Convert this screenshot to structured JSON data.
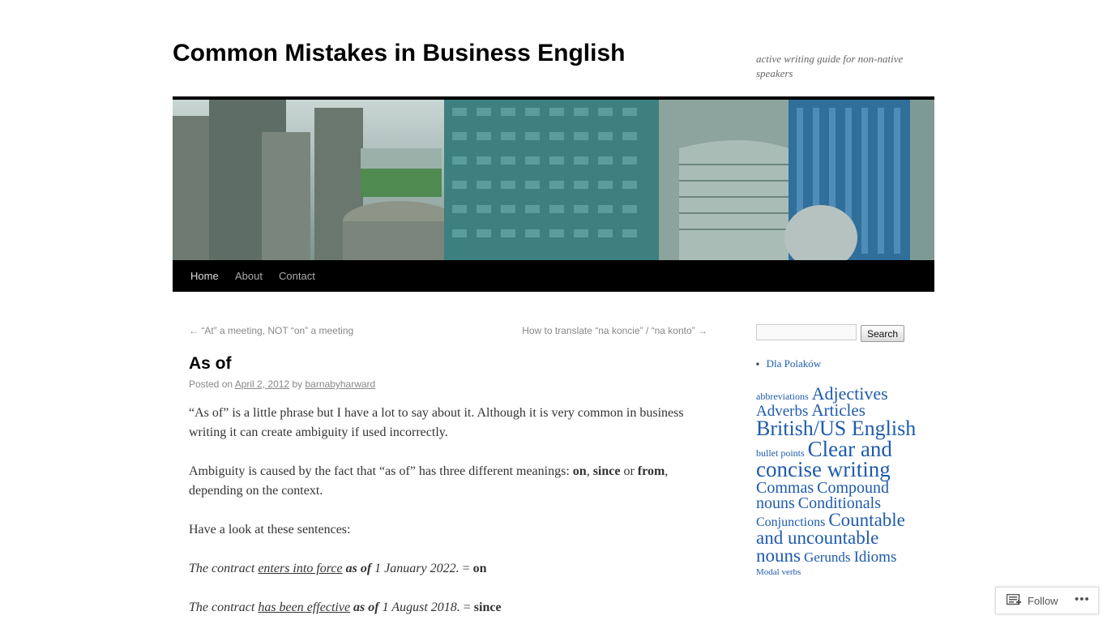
{
  "site": {
    "title": "Common Mistakes in Business English",
    "tagline": "active writing guide for non-native speakers"
  },
  "nav": {
    "items": [
      "Home",
      "About",
      "Contact"
    ]
  },
  "post_nav": {
    "prev_arrow": "←",
    "prev": "“At” a meeting, NOT “on” a meeting",
    "next": "How to translate “na koncie” / “na konto”",
    "next_arrow": "→"
  },
  "post": {
    "title": "As of",
    "posted_on": "Posted on",
    "date": "April 2, 2012",
    "by": "by",
    "author": "barnabyharward",
    "p1": "“As of” is a little phrase but I have a lot to say about it. Although it is very common in business writing it can create ambiguity if used incorrectly.",
    "p2_a": "Ambiguity is caused by the fact that “as of” has three different meanings: ",
    "p2_on": "on",
    "p2_comma": ", ",
    "p2_since": "since",
    "p2_or": " or ",
    "p2_from": "from",
    "p2_b": ", depending on the context.",
    "p3": "Have a look at these sentences:",
    "ex1_a": "The contract ",
    "ex1_u": "enters into force",
    "ex1_sp": " ",
    "ex1_asof": "as of",
    "ex1_date": " 1 January 2022.",
    "ex1_eq": " = ",
    "ex1_mean": "on",
    "ex2_a": "The contract ",
    "ex2_u": "has been effective",
    "ex2_sp": " ",
    "ex2_asof": "as of",
    "ex2_date": " 1 August 2018.",
    "ex2_eq": " = ",
    "ex2_mean": "since"
  },
  "sidebar": {
    "search_placeholder": "",
    "search_button": "Search",
    "categories": [
      "Dla Polaków"
    ],
    "tags": [
      {
        "label": "abbreviations",
        "size": 12
      },
      {
        "label": "Adjectives",
        "size": 22
      },
      {
        "label": "Adverbs",
        "size": 19
      },
      {
        "label": "Articles",
        "size": 21
      },
      {
        "label": "British/US English",
        "size": 26
      },
      {
        "label": "bullet points",
        "size": 12
      },
      {
        "label": "Clear and concise writing",
        "size": 27
      },
      {
        "label": "Commas",
        "size": 20
      },
      {
        "label": "Compound nouns",
        "size": 20
      },
      {
        "label": "Conditionals",
        "size": 20
      },
      {
        "label": "Conjunctions",
        "size": 16
      },
      {
        "label": "Countable and uncountable nouns",
        "size": 23
      },
      {
        "label": "Gerunds",
        "size": 17
      },
      {
        "label": "Idioms",
        "size": 19
      },
      {
        "label": "Modal verbs",
        "size": 11
      }
    ]
  },
  "follow": {
    "label": "Follow",
    "more": "•••"
  },
  "colors": {
    "link": "#1e5bab",
    "nav_bg": "#000000",
    "text": "#333333"
  }
}
